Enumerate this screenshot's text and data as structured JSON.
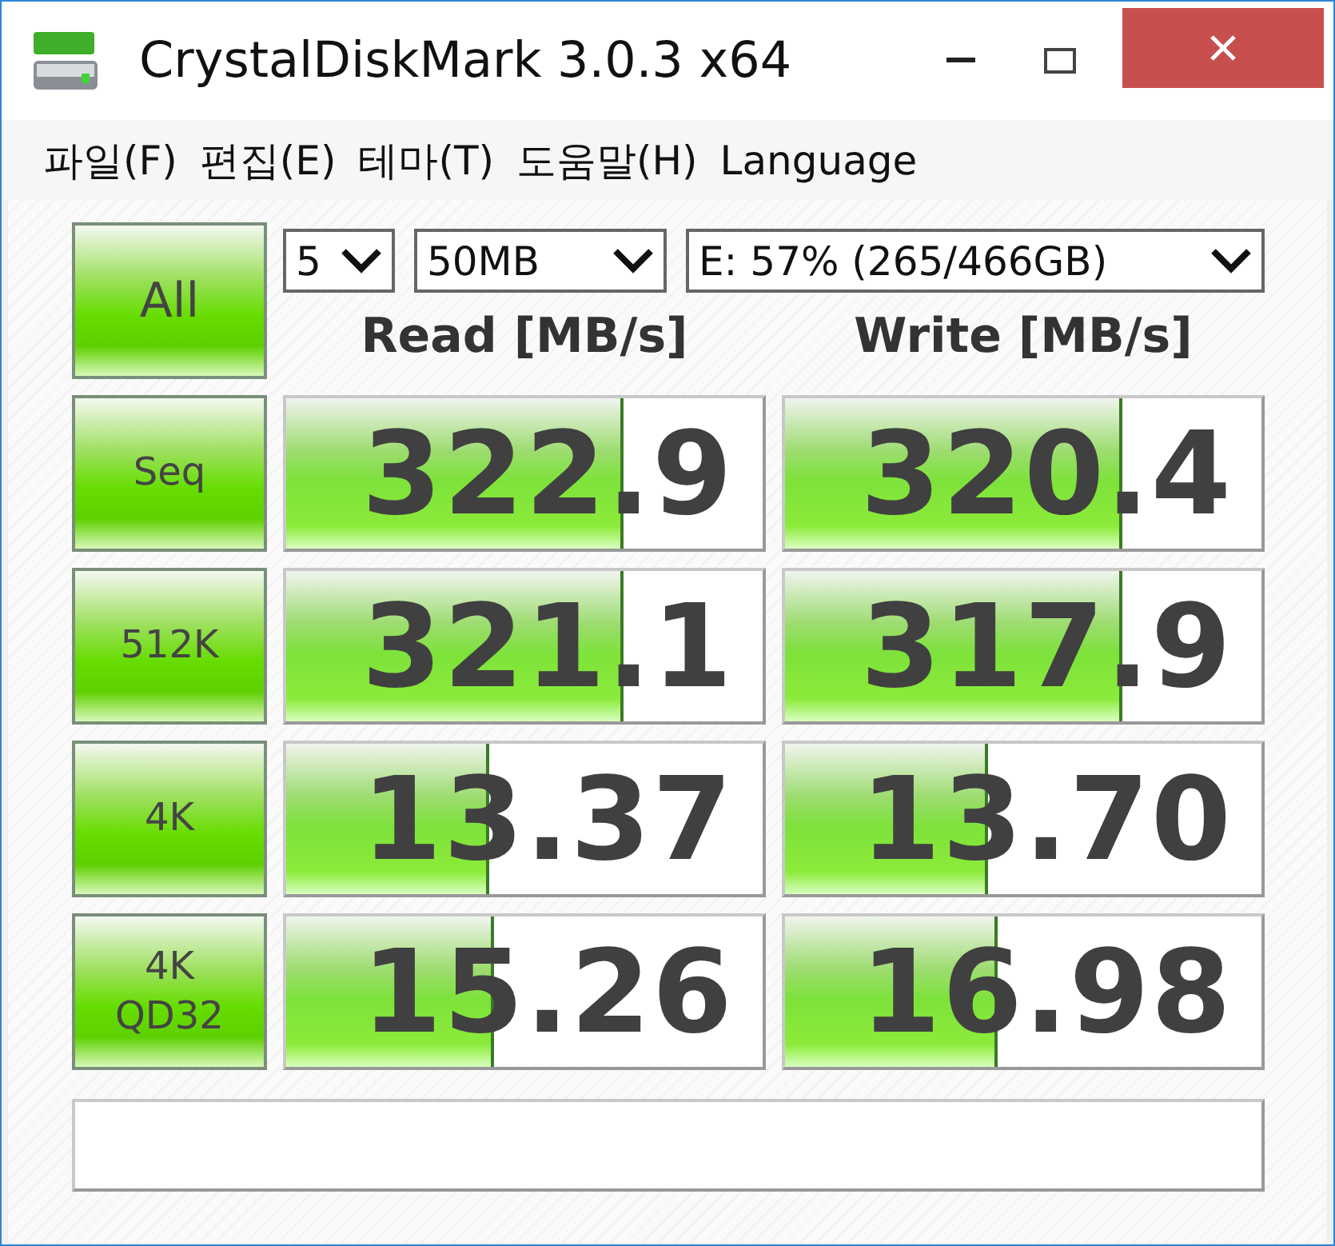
{
  "window": {
    "title": "CrystalDiskMark 3.0.3 x64"
  },
  "menu": [
    "파일(F)",
    "편집(E)",
    "테마(T)",
    "도움말(H)",
    "Language"
  ],
  "all_button": "All",
  "selects": [
    {
      "value": "5"
    },
    {
      "value": "50MB"
    },
    {
      "value": "E: 57% (265/466GB)"
    }
  ],
  "columns": [
    "Read [MB/s]",
    "Write [MB/s]"
  ],
  "rows": [
    {
      "label": [
        "Seq"
      ],
      "read": {
        "value": "322.9",
        "level": 0.7
      },
      "write": {
        "value": "320.4",
        "level": 0.7
      }
    },
    {
      "label": [
        "512K"
      ],
      "read": {
        "value": "321.1",
        "level": 0.7
      },
      "write": {
        "value": "317.9",
        "level": 0.7
      }
    },
    {
      "label": [
        "4K"
      ],
      "read": {
        "value": "13.37",
        "level": 0.42
      },
      "write": {
        "value": "13.70",
        "level": 0.42
      }
    },
    {
      "label": [
        "4K",
        "QD32"
      ],
      "read": {
        "value": "15.26",
        "level": 0.43
      },
      "write": {
        "value": "16.98",
        "level": 0.44
      }
    }
  ]
}
